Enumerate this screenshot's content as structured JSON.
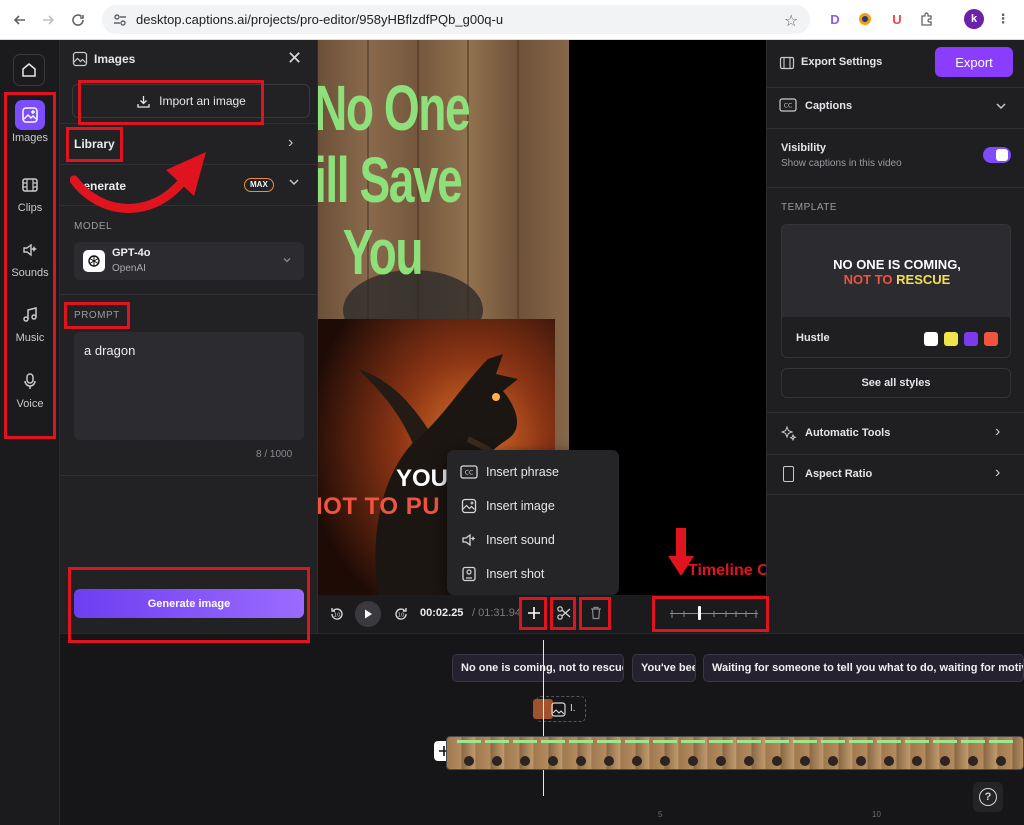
{
  "browser": {
    "url": "desktop.captions.ai/projects/pro-editor/958yHBflzdfPQb_g00q-u",
    "profile_initial": "k"
  },
  "rail": {
    "items": [
      {
        "label": "Images"
      },
      {
        "label": "Clips"
      },
      {
        "label": "Sounds"
      },
      {
        "label": "Music"
      },
      {
        "label": "Voice"
      }
    ]
  },
  "panel": {
    "title": "Images",
    "import_label": "Import an image",
    "library_label": "Library",
    "generate_label": "Generate",
    "max_badge": "MAX",
    "model_heading": "MODEL",
    "model_name": "GPT-4o",
    "model_provider": "OpenAI",
    "prompt_heading": "PROMPT",
    "prompt_value": "a dragon",
    "char_count": "8 / 1000",
    "generate_button": "Generate image"
  },
  "video": {
    "title_lines": [
      "No One",
      "ill Save",
      "You"
    ],
    "overlay_line1": "YOU",
    "overlay_line2": "IOT TO PU"
  },
  "context_menu": {
    "items": [
      "Insert phrase",
      "Insert image",
      "Insert sound",
      "Insert shot"
    ]
  },
  "transport": {
    "current_time": "00:02.25",
    "total_time": "/ 01:31.94"
  },
  "annotation": {
    "label": "Timeline Controller"
  },
  "right": {
    "export_settings": "Export Settings",
    "export_button": "Export",
    "captions_label": "Captions",
    "visibility_title": "Visibility",
    "visibility_sub": "Show captions in this video",
    "template_heading": "TEMPLATE",
    "template_line1": "NO ONE IS COMING,",
    "template_line2a": "NOT TO ",
    "template_line2b": "RESCUE",
    "template_name": "Hustle",
    "see_all_styles": "See all styles",
    "automatic_tools": "Automatic Tools",
    "aspect_ratio": "Aspect Ratio",
    "swatches": [
      "#ffffff",
      "#f2e24b",
      "#7c3aed",
      "#f0533f"
    ]
  },
  "timeline": {
    "captions": [
      "No one is coming, not to rescue y",
      "You've bee",
      "Waiting for someone to tell you what to do, waiting for motivati"
    ],
    "image_chip_label": "I.",
    "ruler_marks": [
      "5",
      "10"
    ],
    "help": "?"
  },
  "colors": {
    "accent": "#7c4dff",
    "export": "#8b3dff",
    "annotation_red": "#e0141e",
    "video_text_green": "#8ee07a"
  }
}
